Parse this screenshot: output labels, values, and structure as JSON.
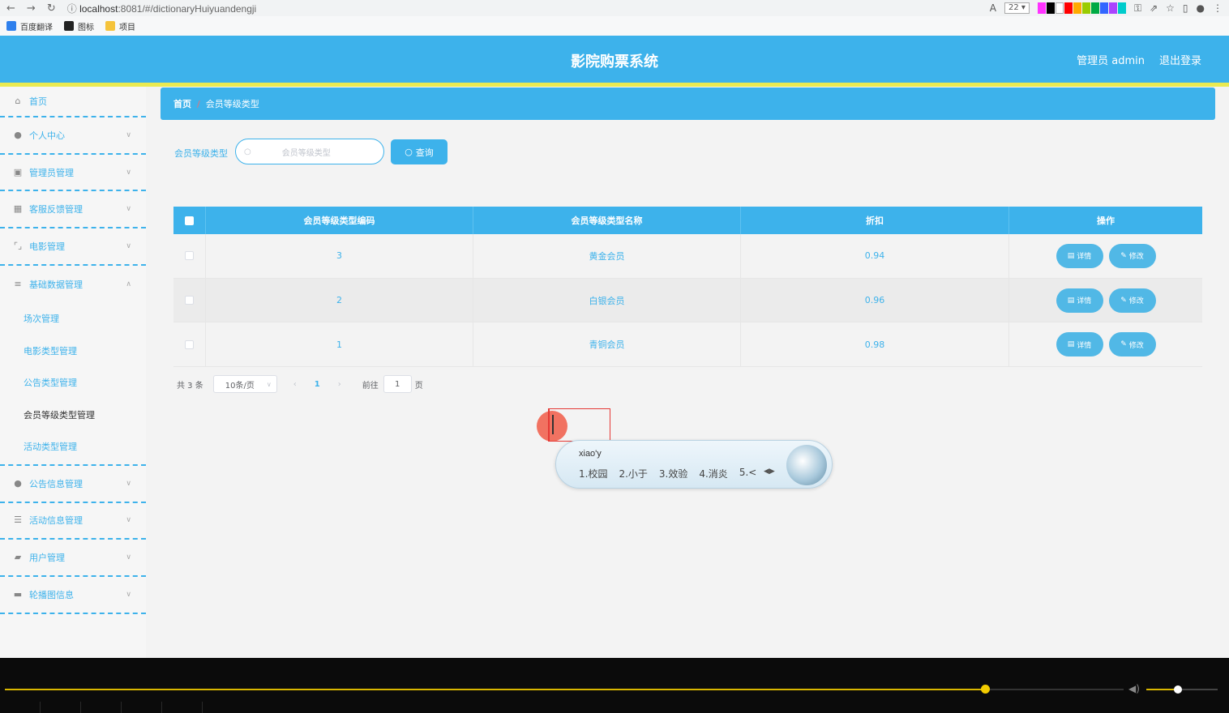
{
  "browser": {
    "url_prefix": "localhost",
    "url_rest": ":8081/#/dictionaryHuiyuandengji",
    "zoom": "22",
    "bookmarks": [
      {
        "label": "百度翻译",
        "color": "#2f80ed"
      },
      {
        "label": "图标",
        "color": "#222222"
      },
      {
        "label": "项目",
        "color": "#f5c33b"
      }
    ],
    "swatches": [
      "#ff33ff",
      "#000000",
      "#ffffff",
      "#888888",
      "#ff0000",
      "#ffaa00",
      "#99cc00",
      "#00aa44",
      "#3366ff",
      "#aa44ff",
      "#00cccc"
    ]
  },
  "header": {
    "title": "影院购票系统",
    "user": "管理员 admin",
    "logout": "退出登录"
  },
  "sidebar": {
    "items": [
      {
        "label": "首页",
        "icon": "home-icon"
      },
      {
        "label": "个人中心",
        "icon": "user-icon"
      },
      {
        "label": "管理员管理",
        "icon": "admin-icon"
      },
      {
        "label": "客服反馈管理",
        "icon": "grid-icon"
      },
      {
        "label": "电影管理",
        "icon": "frame-icon"
      },
      {
        "label": "基础数据管理",
        "icon": "sliders-icon"
      },
      {
        "label": "公告信息管理",
        "icon": "user-icon"
      },
      {
        "label": "活动信息管理",
        "icon": "list-icon"
      },
      {
        "label": "用户管理",
        "icon": "thumb-icon"
      },
      {
        "label": "轮播图信息",
        "icon": "image-icon"
      }
    ],
    "submenu": [
      {
        "label": "场次管理"
      },
      {
        "label": "电影类型管理"
      },
      {
        "label": "公告类型管理"
      },
      {
        "label": "会员等级类型管理"
      },
      {
        "label": "活动类型管理"
      }
    ]
  },
  "breadcrumb": {
    "home": "首页",
    "sep": "/",
    "current": "会员等级类型"
  },
  "search": {
    "label": "会员等级类型",
    "placeholder": "会员等级类型",
    "button": "查询"
  },
  "table": {
    "columns": [
      "会员等级类型编码",
      "会员等级类型名称",
      "折扣",
      "操作"
    ],
    "rows": [
      {
        "code": "3",
        "name": "黄金会员",
        "discount": "0.94"
      },
      {
        "code": "2",
        "name": "白银会员",
        "discount": "0.96"
      },
      {
        "code": "1",
        "name": "青铜会员",
        "discount": "0.98"
      }
    ],
    "detail_label": "详情",
    "edit_label": "修改"
  },
  "pager": {
    "total": "共 3 条",
    "page_size": "10条/页",
    "current_page": "1",
    "goto_label": "前往",
    "goto_value": "1",
    "page_suffix": "页"
  },
  "ime": {
    "pinyin": "xiao'y",
    "candidates": [
      "1.校园",
      "2.小于",
      "3.效验",
      "4.消炎",
      "5.<"
    ]
  },
  "video": {
    "progress": 0.8,
    "volume": 0.8
  }
}
